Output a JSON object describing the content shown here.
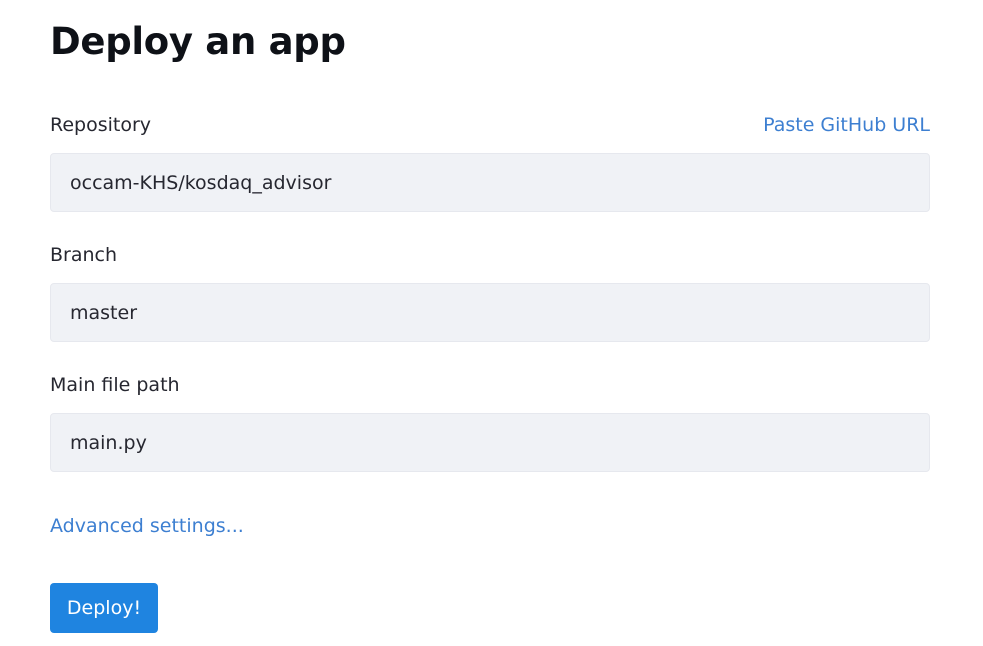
{
  "page": {
    "title": "Deploy an app"
  },
  "form": {
    "repository": {
      "label": "Repository",
      "value": "occam-KHS/kosdaq_advisor",
      "paste_link": "Paste GitHub URL"
    },
    "branch": {
      "label": "Branch",
      "value": "master"
    },
    "main_file": {
      "label": "Main file path",
      "value": "main.py"
    },
    "advanced_link": "Advanced settings...",
    "deploy_label": "Deploy!"
  },
  "colors": {
    "link": "#3d7fd1",
    "primary_button": "#1f84e0",
    "input_background": "#f0f2f6"
  }
}
